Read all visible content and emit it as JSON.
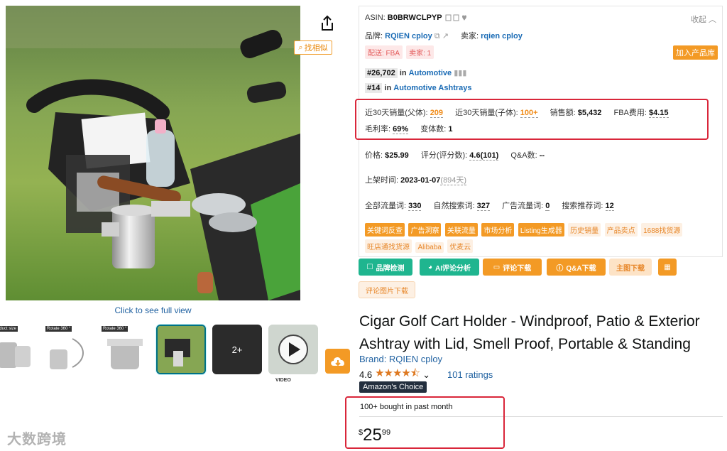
{
  "gallery": {
    "find_similar": "找相似",
    "full_view": "Click to see full view",
    "thumb_captions": [
      "Product size",
      "Rotate 360 °",
      "Rotate 360 °"
    ],
    "more_count": "2+",
    "video_label": "VIDEO"
  },
  "panel": {
    "asin_label": "ASIN:",
    "asin": "B0BRWCLPYP",
    "collapse": "收起",
    "brand_label": "品牌:",
    "brand": "RQIEN cploy",
    "seller_label": "卖家:",
    "seller": "rqien cploy",
    "fba_tag": "配送: FBA",
    "seller_count_tag": "卖家: 1",
    "add_button": "加入产品库",
    "ranks": [
      {
        "num": "#26,702",
        "in": "in",
        "cat": "Automotive"
      },
      {
        "num": "#14",
        "in": "in",
        "cat": "Automotive Ashtrays"
      }
    ],
    "sales_parent_label": "近30天销量(父体):",
    "sales_parent": "209",
    "sales_child_label": "近30天销量(子体):",
    "sales_child": "100+",
    "revenue_label": "销售额:",
    "revenue": "$5,432",
    "fba_fee_label": "FBA费用:",
    "fba_fee": "$4.15",
    "margin_label": "毛利率:",
    "margin": "69%",
    "variants_label": "变体数:",
    "variants": "1",
    "price_label": "价格:",
    "price": "$25.99",
    "rating_label": "评分(评分数):",
    "rating": "4.6(101)",
    "qa_label": "Q&A数:",
    "qa": "--",
    "launch_label": "上架时间:",
    "launch_date": "2023-01-07",
    "launch_days": "(894天)",
    "traffic_label": "全部流量词:",
    "traffic": "330",
    "organic_label": "自然搜索词:",
    "organic": "327",
    "ad_label": "广告流量词:",
    "ad": "0",
    "recommend_label": "搜索推荐词:",
    "recommend": "12",
    "pills_solid": [
      "关键词反查",
      "广告洞察",
      "关联流量",
      "市场分析",
      "Listing生成器"
    ],
    "pills_light": [
      "历史销量",
      "产品卖点",
      "1688找货源",
      "旺店通找货源",
      "Alibaba",
      "优麦云"
    ]
  },
  "actions": {
    "brand_check": "品牌检测",
    "ai_review": "AI评论分析",
    "review_download": "评论下载",
    "qa_download": "Q&A下载",
    "main_image_download": "主图下载",
    "review_image_download": "评论图片下载"
  },
  "product": {
    "title": "Cigar Golf Cart Holder - Windproof, Patio & Exterior Ashtray with Lid, Smell Proof, Portable & Standing",
    "brand": "Brand: RQIEN cploy",
    "rating": "4.6",
    "stars": "★★★★⯪",
    "ratings_count": "101 ratings",
    "choice_badge": "Amazon's Choice",
    "bought": "100+ bought in past month",
    "price_symbol": "$",
    "price_whole": "25",
    "price_fraction": "99"
  },
  "watermark": "大数跨境",
  "colors": {
    "accent": "#f39a25",
    "highlight_box": "#d9263a",
    "link": "#2162a1",
    "green": "#1fb58f"
  }
}
